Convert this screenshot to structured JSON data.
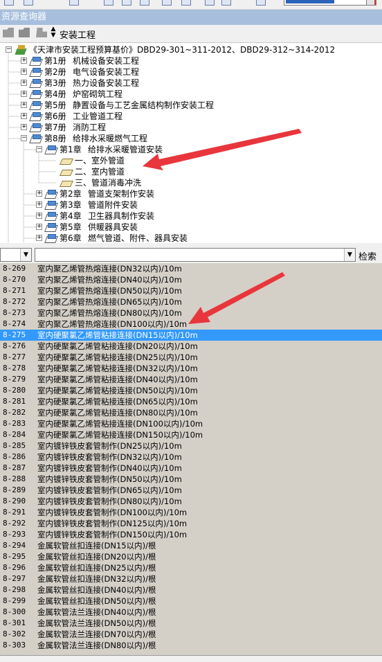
{
  "panel": {
    "title": "资源查询器"
  },
  "toolbar": {
    "path": "安装工程"
  },
  "tree": {
    "root": "《天津市安装工程预算基价》DBD29-301~311-2012、DBD29-312~314-2012",
    "volumes": [
      {
        "num": "第1册",
        "title": "机械设备安装工程"
      },
      {
        "num": "第2册",
        "title": "电气设备安装工程"
      },
      {
        "num": "第3册",
        "title": "热力设备安装工程"
      },
      {
        "num": "第4册",
        "title": "炉窑砌筑工程"
      },
      {
        "num": "第5册",
        "title": "静置设备与工艺金属结构制作安装工程"
      },
      {
        "num": "第6册",
        "title": "工业管道工程"
      },
      {
        "num": "第7册",
        "title": "消防工程"
      },
      {
        "num": "第8册",
        "title": "给排水采暖燃气工程"
      }
    ],
    "chapter_open": {
      "num": "第1章",
      "title": "给排水采暖管道安装"
    },
    "sections": [
      "一、室外管道",
      "二、室内管道",
      "三、管道消毒冲洗"
    ],
    "chapters": [
      {
        "num": "第2章",
        "title": "管道支架制作安装"
      },
      {
        "num": "第3章",
        "title": "管道附件安装"
      },
      {
        "num": "第4章",
        "title": "卫生器具制作安装"
      },
      {
        "num": "第5章",
        "title": "供暖器具安装"
      },
      {
        "num": "第6章",
        "title": "燃气管道、附件、器具安装"
      }
    ]
  },
  "filter": {
    "search_label": "检索"
  },
  "list": {
    "selected_code": "8-275",
    "rows": [
      {
        "code": "8-269",
        "name": "室内聚乙烯管热熔连接(DN32以内)/10m"
      },
      {
        "code": "8-270",
        "name": "室内聚乙烯管热熔连接(DN40以内)/10m"
      },
      {
        "code": "8-271",
        "name": "室内聚乙烯管热熔连接(DN50以内)/10m"
      },
      {
        "code": "8-272",
        "name": "室内聚乙烯管热熔连接(DN65以内)/10m"
      },
      {
        "code": "8-273",
        "name": "室内聚乙烯管热熔连接(DN80以内)/10m"
      },
      {
        "code": "8-274",
        "name": "室内聚乙烯管热熔连接(DN100以内)/10m"
      },
      {
        "code": "8-275",
        "name": "室内硬聚氯乙烯管粘接连接(DN15以内)/10m"
      },
      {
        "code": "8-276",
        "name": "室内硬聚氯乙烯管粘接连接(DN20以内)/10m"
      },
      {
        "code": "8-277",
        "name": "室内硬聚氯乙烯管粘接连接(DN25以内)/10m"
      },
      {
        "code": "8-278",
        "name": "室内硬聚氯乙烯管粘接连接(DN32以内)/10m"
      },
      {
        "code": "8-279",
        "name": "室内硬聚氯乙烯管粘接连接(DN40以内)/10m"
      },
      {
        "code": "8-280",
        "name": "室内硬聚氯乙烯管粘接连接(DN50以内)/10m"
      },
      {
        "code": "8-281",
        "name": "室内硬聚氯乙烯管粘接连接(DN65以内)/10m"
      },
      {
        "code": "8-282",
        "name": "室内硬聚氯乙烯管粘接连接(DN80以内)/10m"
      },
      {
        "code": "8-283",
        "name": "室内硬聚氯乙烯管粘接连接(DN100以内)/10m"
      },
      {
        "code": "8-284",
        "name": "室内硬聚氯乙烯管粘接连接(DN150以内)/10m"
      },
      {
        "code": "8-285",
        "name": "室内镀锌铁皮套管制作(DN25以内)/10m"
      },
      {
        "code": "8-286",
        "name": "室内镀锌铁皮套管制作(DN32以内)/10m"
      },
      {
        "code": "8-287",
        "name": "室内镀锌铁皮套管制作(DN40以内)/10m"
      },
      {
        "code": "8-288",
        "name": "室内镀锌铁皮套管制作(DN50以内)/10m"
      },
      {
        "code": "8-289",
        "name": "室内镀锌铁皮套管制作(DN65以内)/10m"
      },
      {
        "code": "8-290",
        "name": "室内镀锌铁皮套管制作(DN80以内)/10m"
      },
      {
        "code": "8-291",
        "name": "室内镀锌铁皮套管制作(DN100以内)/10m"
      },
      {
        "code": "8-292",
        "name": "室内镀锌铁皮套管制作(DN125以内)/10m"
      },
      {
        "code": "8-293",
        "name": "室内镀锌铁皮套管制作(DN150以内)/10m"
      },
      {
        "code": "8-294",
        "name": "金属软管丝扣连接(DN15以内)/根"
      },
      {
        "code": "8-295",
        "name": "金属软管丝扣连接(DN20以内)/根"
      },
      {
        "code": "8-296",
        "name": "金属软管丝扣连接(DN25以内)/根"
      },
      {
        "code": "8-297",
        "name": "金属软管丝扣连接(DN32以内)/根"
      },
      {
        "code": "8-298",
        "name": "金属软管丝扣连接(DN40以内)/根"
      },
      {
        "code": "8-299",
        "name": "金属软管丝扣连接(DN50以内)/根"
      },
      {
        "code": "8-300",
        "name": "金属软管法兰连接(DN40以内)/根"
      },
      {
        "code": "8-301",
        "name": "金属软管法兰连接(DN50以内)/根"
      },
      {
        "code": "8-302",
        "name": "金属软管法兰连接(DN70以内)/根"
      },
      {
        "code": "8-303",
        "name": "金属软管法兰连接(DN80以内)/根"
      }
    ]
  },
  "colors": {
    "title_bar": "#a7bfdd",
    "selection": "#3399ff",
    "list_bg": "#d4d0c8",
    "arrow": "#e8363c"
  }
}
